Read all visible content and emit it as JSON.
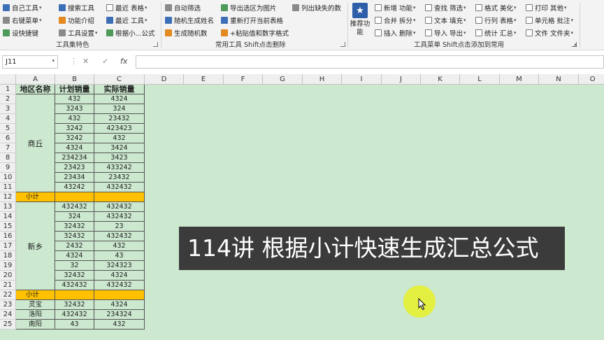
{
  "ribbon": {
    "col1": [
      "自己工具",
      "右键菜单",
      "设快捷键"
    ],
    "col2": [
      "搜索工具",
      "功能介绍",
      "工具设置"
    ],
    "col3": [
      "最近 表格",
      "最近 工具",
      "根据小...公式"
    ],
    "group1_title": "工具集特色",
    "col4": [
      "自动筛选",
      "随机生成姓名",
      "生成随机数"
    ],
    "col5": [
      "导出选区为图片",
      "重新打开当前表格",
      "+粘贴值和数字格式"
    ],
    "col6": [
      "列出缺失的数"
    ],
    "group2_title": "常用工具 Shift点击删除",
    "recommend_label": "推荐功能",
    "col7": [
      "新增 功能",
      "合并 拆分",
      "插入 删除"
    ],
    "col8": [
      "查找 筛选",
      "文本 填充",
      "导入 导出"
    ],
    "col9": [
      "格式 美化",
      "行列 表格",
      "统计 汇总"
    ],
    "col10": [
      "打印 其他",
      "单元格 批注",
      "文件 文件夹"
    ],
    "group3_title": "工具菜单 Shift点击添加到常用",
    "collapse_icon": "chevron-up-icon"
  },
  "formula_bar": {
    "name_box": "J11",
    "cancel_symbol": "✕",
    "enter_symbol": "✓",
    "fx_symbol": "fx",
    "formula_value": ""
  },
  "sheet": {
    "columns": [
      "A",
      "B",
      "C",
      "D",
      "E",
      "F",
      "G",
      "H",
      "I",
      "J",
      "K",
      "L",
      "M",
      "N",
      "O"
    ],
    "rows": [
      "1",
      "2",
      "3",
      "4",
      "5",
      "6",
      "7",
      "8",
      "9",
      "10",
      "11",
      "12",
      "13",
      "14",
      "15",
      "16",
      "17",
      "18",
      "19",
      "20",
      "21",
      "22",
      "23",
      "24",
      "25"
    ],
    "header": [
      "地区名称",
      "计划销量",
      "实际销量"
    ],
    "group1_region": "商丘",
    "group1_rows": [
      [
        "432",
        "4324"
      ],
      [
        "3243",
        "324"
      ],
      [
        "432",
        "23432"
      ],
      [
        "3242",
        "423423"
      ],
      [
        "3242",
        "432"
      ],
      [
        "4324",
        "3424"
      ],
      [
        "234234",
        "3423"
      ],
      [
        "23423",
        "433242"
      ],
      [
        "23434",
        "23432"
      ],
      [
        "43242",
        "432432"
      ]
    ],
    "subtotal_label": "小计",
    "group2_region": "新乡",
    "group2_rows": [
      [
        "432432",
        "432432"
      ],
      [
        "324",
        "432432"
      ],
      [
        "32432",
        "23"
      ],
      [
        "32432",
        "432432"
      ],
      [
        "2432",
        "432"
      ],
      [
        "4324",
        "43"
      ],
      [
        "32",
        "324323"
      ],
      [
        "32432",
        "4324"
      ],
      [
        "432432",
        "432432"
      ]
    ],
    "subtotal2_label": "小计",
    "tail_rows": [
      [
        "灵宝",
        "32432",
        "4324"
      ],
      [
        "洛阳",
        "432432",
        "234324"
      ],
      [
        "南阳",
        "43",
        "432"
      ]
    ]
  },
  "overlay": {
    "title": "114讲  根据小计快速生成汇总公式"
  }
}
